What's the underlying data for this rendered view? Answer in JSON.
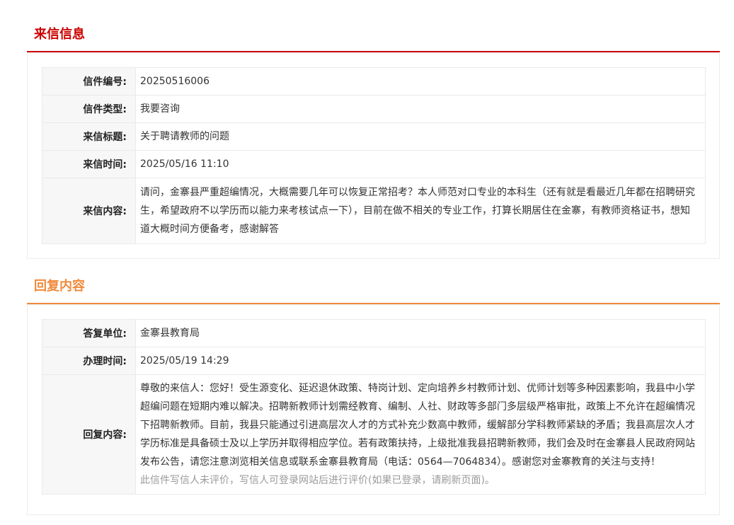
{
  "colors": {
    "letter_accent": "#cc0000",
    "reply_accent": "#f08a3c"
  },
  "letter": {
    "section_title": "来信信息",
    "rows": [
      {
        "label": "信件编号:",
        "value": "20250516006"
      },
      {
        "label": "信件类型:",
        "value": "我要咨询"
      },
      {
        "label": "来信标题:",
        "value": "关于聘请教师的问题"
      },
      {
        "label": "来信时间:",
        "value": "2025/05/16 11:10"
      },
      {
        "label": "来信内容:",
        "value": "请问，金寨县严重超编情况，大概需要几年可以恢复正常招考？本人师范对口专业的本科生（还有就是看最近几年都在招聘研究生，希望政府不以学历而以能力来考核试点一下），目前在做不相关的专业工作，打算长期居住在金寨，有教师资格证书，想知道大概时间方便备考，感谢解答"
      }
    ]
  },
  "reply": {
    "section_title": "回复内容",
    "rows": [
      {
        "label": "答复单位:",
        "value": "金寨县教育局"
      },
      {
        "label": "办理时间:",
        "value": "2025/05/19 14:29"
      },
      {
        "label": "回复内容:",
        "value": "尊敬的来信人：您好！受生源变化、延迟退休政策、特岗计划、定向培养乡村教师计划、优师计划等多种因素影响，我县中小学超编问题在短期内难以解决。招聘新教师计划需经教育、编制、人社、财政等多部门多层级严格审批，政策上不允许在超编情况下招聘新教师。目前，我县只能通过引进高层次人才的方式补充少数高中教师，缓解部分学科教师紧缺的矛盾；我县高层次人才学历标准是具备硕士及以上学历并取得相应学位。若有政策扶持，上级批准我县招聘新教师，我们会及时在金寨县人民政府网站发布公告，请您注意浏览相关信息或联系金寨县教育局（电话：0564—7064834）。感谢您对金寨教育的关注与支持！"
      }
    ],
    "evaluation_note": "此信件写信人未评价，写信人可登录网站后进行评价(如果已登录，请刷新页面)。"
  }
}
